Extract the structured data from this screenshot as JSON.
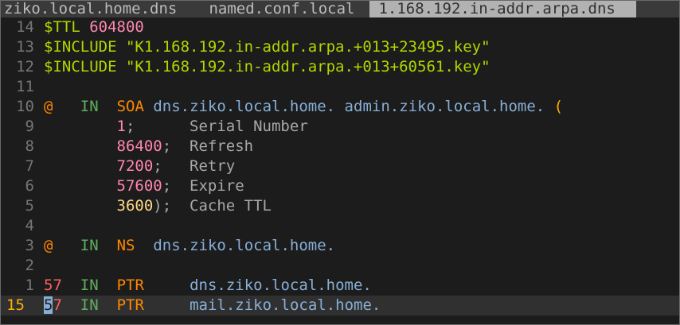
{
  "tabs": [
    {
      "label": "ziko.local.home.dns ",
      "active": false
    },
    {
      "label": " named.conf.local ",
      "active": false
    },
    {
      "label": " 1.168.192.in-addr.arpa.dns ",
      "active": true
    }
  ],
  "lines": [
    {
      "num": "14",
      "tokens": [
        {
          "t": "$TTL ",
          "c": "c-kw"
        },
        {
          "t": "604800",
          "c": "c-num"
        }
      ]
    },
    {
      "num": "13",
      "tokens": [
        {
          "t": "$INCLUDE ",
          "c": "c-kw"
        },
        {
          "t": "\"K1.168.192.in-addr.arpa.+013+23495.key\"",
          "c": "c-str"
        }
      ]
    },
    {
      "num": "12",
      "tokens": [
        {
          "t": "$INCLUDE ",
          "c": "c-kw"
        },
        {
          "t": "\"K1.168.192.in-addr.arpa.+013+60561.key\"",
          "c": "c-str"
        }
      ]
    },
    {
      "num": "11",
      "tokens": []
    },
    {
      "num": "10",
      "tokens": [
        {
          "t": "@",
          "c": "c-orange"
        },
        {
          "t": "   ",
          "c": ""
        },
        {
          "t": "IN",
          "c": "c-in"
        },
        {
          "t": "  ",
          "c": ""
        },
        {
          "t": "SOA",
          "c": "c-soa"
        },
        {
          "t": " ",
          "c": ""
        },
        {
          "t": "dns.ziko.local.home. admin.ziko.local.home.",
          "c": "c-name"
        },
        {
          "t": " (",
          "c": "c-paren"
        }
      ]
    },
    {
      "num": "9",
      "tokens": [
        {
          "t": "        ",
          "c": ""
        },
        {
          "t": "1",
          "c": "c-val"
        },
        {
          "t": ";      ",
          "c": "c-com"
        },
        {
          "t": "Serial Number",
          "c": "c-com"
        }
      ]
    },
    {
      "num": "8",
      "tokens": [
        {
          "t": "        ",
          "c": ""
        },
        {
          "t": "86400",
          "c": "c-val"
        },
        {
          "t": ";  ",
          "c": "c-com"
        },
        {
          "t": "Refresh",
          "c": "c-com"
        }
      ]
    },
    {
      "num": "7",
      "tokens": [
        {
          "t": "        ",
          "c": ""
        },
        {
          "t": "7200",
          "c": "c-val"
        },
        {
          "t": ";   ",
          "c": "c-com"
        },
        {
          "t": "Retry",
          "c": "c-com"
        }
      ]
    },
    {
      "num": "6",
      "tokens": [
        {
          "t": "        ",
          "c": ""
        },
        {
          "t": "57600",
          "c": "c-val"
        },
        {
          "t": ";  ",
          "c": "c-com"
        },
        {
          "t": "Expire",
          "c": "c-com"
        }
      ]
    },
    {
      "num": "5",
      "tokens": [
        {
          "t": "        ",
          "c": ""
        },
        {
          "t": "3600",
          "c": "c-yel"
        },
        {
          "t": ");  ",
          "c": "c-com"
        },
        {
          "t": "Cache TTL",
          "c": "c-com"
        }
      ]
    },
    {
      "num": "4",
      "tokens": []
    },
    {
      "num": "3",
      "tokens": [
        {
          "t": "@",
          "c": "c-orange"
        },
        {
          "t": "   ",
          "c": ""
        },
        {
          "t": "IN",
          "c": "c-in"
        },
        {
          "t": "  ",
          "c": ""
        },
        {
          "t": "NS",
          "c": "c-soa"
        },
        {
          "t": "  ",
          "c": ""
        },
        {
          "t": "dns.ziko.local.home.",
          "c": "c-name"
        }
      ]
    },
    {
      "num": "2",
      "tokens": []
    },
    {
      "num": "1",
      "tokens": [
        {
          "t": "57",
          "c": "c-ptrnum"
        },
        {
          "t": "  ",
          "c": ""
        },
        {
          "t": "IN",
          "c": "c-in"
        },
        {
          "t": "  ",
          "c": ""
        },
        {
          "t": "PTR",
          "c": "c-soa"
        },
        {
          "t": "     ",
          "c": ""
        },
        {
          "t": "dns.ziko.local.home.",
          "c": "c-name"
        }
      ]
    },
    {
      "num": "15",
      "current": true,
      "tokens": [
        {
          "t": "5",
          "c": "cursor"
        },
        {
          "t": "7",
          "c": "c-ptrnum"
        },
        {
          "t": "  ",
          "c": ""
        },
        {
          "t": "IN",
          "c": "c-in"
        },
        {
          "t": "  ",
          "c": ""
        },
        {
          "t": "PTR",
          "c": "c-soa"
        },
        {
          "t": "     ",
          "c": ""
        },
        {
          "t": "mail.ziko.local.home.",
          "c": "c-name"
        }
      ]
    }
  ]
}
